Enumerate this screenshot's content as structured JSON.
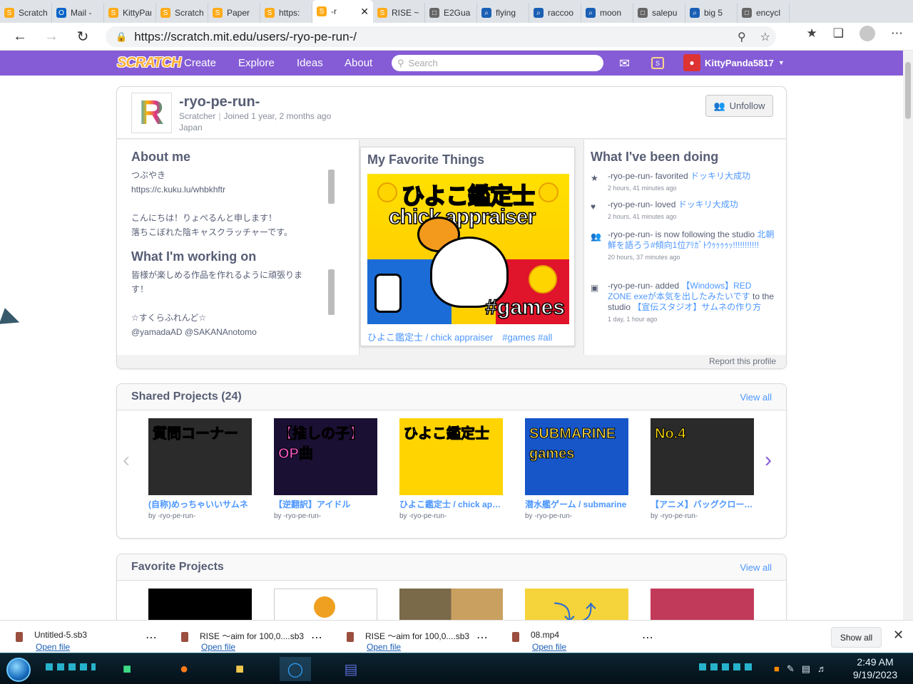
{
  "browser": {
    "tabs": [
      {
        "label": "Scratch",
        "icon": "scratch-icon",
        "color": "#ffab19"
      },
      {
        "label": "Mail -",
        "icon": "outlook-icon",
        "color": "#0a64c8"
      },
      {
        "label": "KittyPanda",
        "icon": "scratch-icon",
        "color": "#ffab19"
      },
      {
        "label": "Scratch",
        "icon": "scratch-icon",
        "color": "#ffab19"
      },
      {
        "label": "Paper",
        "icon": "scratch-icon",
        "color": "#ffab19"
      },
      {
        "label": "https:",
        "icon": "scratch-icon",
        "color": "#ffab19"
      },
      {
        "label": "-r",
        "icon": "scratch-icon",
        "color": "#ffab19",
        "active": true
      },
      {
        "label": "RISE ~",
        "icon": "scratch-icon",
        "color": "#ffab19"
      },
      {
        "label": "E2Gua",
        "icon": "document-icon",
        "color": "#666666"
      },
      {
        "label": "flying",
        "icon": "search-icon",
        "color": "#1a5fb4"
      },
      {
        "label": "raccoo",
        "icon": "search-icon",
        "color": "#1a5fb4"
      },
      {
        "label": "moon",
        "icon": "search-icon",
        "color": "#1a5fb4"
      },
      {
        "label": "salepu",
        "icon": "document-icon",
        "color": "#666666"
      },
      {
        "label": "big 5",
        "icon": "search-icon",
        "color": "#1a5fb4"
      },
      {
        "label": "encycl",
        "icon": "document-icon",
        "color": "#666666"
      }
    ],
    "url": "https://scratch.mit.edu/users/-ryo-pe-run-/"
  },
  "nav": {
    "logo": "SCRATCH",
    "links": [
      "Create",
      "Explore",
      "Ideas",
      "About"
    ],
    "search_placeholder": "Search",
    "username": "KittyPanda5817"
  },
  "profile": {
    "username": "-ryo-pe-run-",
    "role": "Scratcher",
    "joined": "Joined 1 year, 2 months ago",
    "location": "Japan",
    "unfollow_label": "Unfollow",
    "about_title": "About me",
    "about_lines": [
      "つぶやき",
      "https://c.kuku.lu/whbkhftr",
      "",
      "こんにちは！りょぺるんと申します！",
      "落ちこぼれた陰キャスクラッチャーです。"
    ],
    "working_title": "What I'm working on",
    "working_lines": [
      "皆様が楽しめる作品を作れるように頑張りま",
      "す！",
      "",
      "☆すくらふれんど☆",
      "@yamadaAD @SAKANAnotomo"
    ],
    "favorite_title": "My Favorite Things",
    "favorite_caption": "ひよこ鑑定士 / chick appraiser　#games #all",
    "favorite_art": {
      "line1": "ひよこ鑑定士",
      "line2": "chick appraiser",
      "tag": "#games"
    },
    "activity_title": "What I've been doing",
    "activity": [
      {
        "icon": "star-icon",
        "pre": "-ryo-pe-run- favorited ",
        "link": "ドッキリ大成功",
        "post": "",
        "time": "2 hours, 41 minutes ago"
      },
      {
        "icon": "heart-icon",
        "pre": "-ryo-pe-run- loved ",
        "link": "ドッキリ大成功",
        "post": "",
        "time": "2 hours, 41 minutes ago"
      },
      {
        "icon": "users-icon",
        "pre": "-ryo-pe-run- is now following the studio ",
        "link": "北朝鮮を語ろう#傾向1位ｱﾘｶﾞﾄｳｩｩｩｩｯ!!!!!!!!!!!",
        "post": "",
        "time": "20 hours, 37 minutes ago"
      },
      {
        "icon": "studio-icon",
        "pre": "-ryo-pe-run- added ",
        "link": "【Windows】RED ZONE exeが本気を出したみたいです",
        "post": " to the studio ",
        "link2": "【宣伝スタジオ】サムネの作り方",
        "time": "1 day, 1 hour ago"
      }
    ],
    "report_label": "Report this profile"
  },
  "shared": {
    "title": "Shared Projects (24)",
    "view_all": "View all",
    "projects": [
      {
        "title": "(自称)めっちゃいいサムネ",
        "by": "by -ryo-pe-run-",
        "art": "質問コーナー",
        "bg": "#2b2b2b",
        "fg": "#ff3b3b"
      },
      {
        "title": "【逆翻訳】アイドル",
        "by": "by -ryo-pe-run-",
        "art": "【推しの子】OP曲",
        "bg": "#1a1033",
        "fg": "#ff5ccf"
      },
      {
        "title": "ひよこ鑑定士 / chick appraiser",
        "by": "by -ryo-pe-run-",
        "art": "ひよこ鑑定士",
        "bg": "#ffd400",
        "fg": "#ffffff"
      },
      {
        "title": "潜水艦ゲーム / submarine",
        "by": "by -ryo-pe-run-",
        "art": "SUBMARINE games",
        "bg": "#1656c9",
        "fg": "#ffe04a"
      },
      {
        "title": "【アニメ】バッグクロージャー",
        "by": "by -ryo-pe-run-",
        "art": "No.4",
        "bg": "#2a2a2a",
        "fg": "#ffdd00"
      }
    ]
  },
  "favorites": {
    "title": "Favorite Projects",
    "view_all": "View all"
  },
  "downloads": {
    "items": [
      {
        "name": "Untitled-5.sb3",
        "open": "Open file"
      },
      {
        "name": "RISE ～aim for 100,0....sb3",
        "open": "Open file"
      },
      {
        "name": "RISE ～aim for 100,0....sb3",
        "open": "Open file"
      },
      {
        "name": "08.mp4",
        "open": "Open file"
      }
    ],
    "show_all": "Show all"
  },
  "taskbar": {
    "time": "2:49 AM",
    "date": "9/19/2023"
  },
  "colors": {
    "scratch_purple": "#855cd6",
    "link_blue": "#4d97ff",
    "text": "#575e75"
  }
}
